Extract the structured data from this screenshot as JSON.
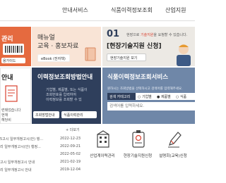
{
  "nav": {
    "items": [
      "안내서비스",
      "식품이력정보조회",
      "산업지원"
    ]
  },
  "tiles": {
    "t1": {
      "title": "관리",
      "button": "용가이드"
    },
    "t2": {
      "line1": "매뉴얼",
      "line2": "교육 · 홍보자료",
      "button": "eBook (전자책)"
    },
    "t3": {
      "badge": "01",
      "headline_prefix": "현장으로 ",
      "headline_highlight": "기술지원",
      "headline_suffix": "을 요청할 수 있습니다.",
      "title": "[현장기술지원 신청]",
      "button": "현장기술지원 보기"
    },
    "t4": {
      "title": "안내",
      "lines": [
        "련돼었습니다",
        "현재",
        "해당비"
      ]
    },
    "t5": {
      "title": "이력정보조회방법안내",
      "lines": [
        "기업별, 제품별, 또는 식품이",
        "조회번호를 입력하여",
        "이력정보를 조회할 수 있"
      ],
      "button1": "조회방법안내",
      "button2": "식품이력관리"
    },
    "t6": {
      "title": "식품이력정보조회서비스",
      "desc": "원하시는 조회방법을 선택하시고 검색어를 입력해주세요.",
      "search_label": "검색 카테고리",
      "radios": [
        "기업별",
        "제품별",
        "식품"
      ],
      "placeholder": "검색어를 입력하세요."
    }
  },
  "news": {
    "more": "+ 더보기",
    "rows": [
      {
        "title": "5고시 일부개정고시(안) 행...",
        "date": "2022-12-23"
      },
      {
        "title": "리 일부개정고시(안) 행정...",
        "date": "2022-09-21"
      },
      {
        "title": "",
        "date": "2022-05-02"
      },
      {
        "title": "고시 일부개정고시 안내",
        "date": "2021-02-19"
      },
      {
        "title": "리 일부개정고시 안내",
        "date": "2019-12-04"
      }
    ]
  },
  "services": [
    {
      "name": "산업계이력관리",
      "icon": "building-icon"
    },
    {
      "name": "현장기술지원신청",
      "icon": "id-badge-icon"
    },
    {
      "name": "설명회(교육)신청",
      "icon": "pencil-icon"
    }
  ],
  "colors": {
    "orange": "#e56a3f",
    "navy": "#2f3f5c",
    "slate": "#6f87a8",
    "accent_red": "#d9412f"
  }
}
